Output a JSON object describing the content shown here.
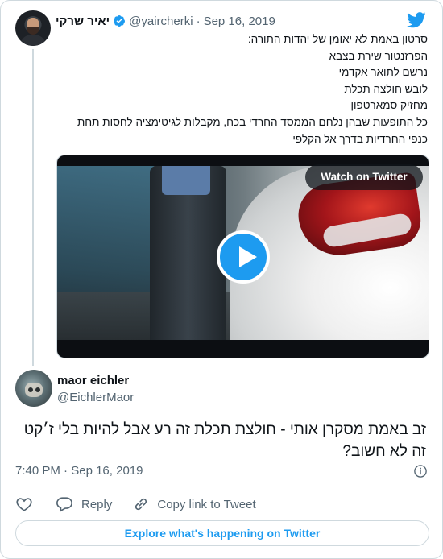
{
  "parent_tweet": {
    "author_name": "יאיר שרקי",
    "handle": "@yaircherki",
    "separator": "·",
    "date": "Sep 16, 2019",
    "lines": [
      "סרטון באמת לא יאומן של יהדות התורה:",
      "הפרזנטור שירת בצבא",
      "נרשם לתואר אקדמי",
      "לובש חולצה תכלת",
      "מחזיק סמארטפון",
      "כל התופעות שבהן נלחם הממסד החרדי בכח, מקבלות לגיטימציה לחסות תחת",
      "כנפי החרדיות בדרך אל הקלפי"
    ],
    "video": {
      "watch_label": "Watch on Twitter"
    }
  },
  "reply_tweet": {
    "author_name": "maor eichler",
    "handle": "@EichlerMaor",
    "lines": [
      "זב באמת מסקרן אותי - חולצת תכלת זה רע אבל להיות בלי ז׳קט",
      "זה לא חשוב?"
    ],
    "time": "7:40 PM",
    "separator": "·",
    "date": "Sep 16, 2019"
  },
  "actions": {
    "reply_label": "Reply",
    "copy_link_label": "Copy link to Tweet"
  },
  "explore_label": "Explore what's happening on Twitter",
  "icons": {
    "brand": "twitter-bird-icon",
    "verified": "verified-badge-icon",
    "play": "play-icon",
    "info": "info-icon",
    "like": "heart-icon",
    "reply": "reply-bubble-icon",
    "link": "link-icon"
  },
  "colors": {
    "accent": "#1d9bf0",
    "text": "#0f1419",
    "secondary": "#536471",
    "border": "#cfd9de"
  }
}
